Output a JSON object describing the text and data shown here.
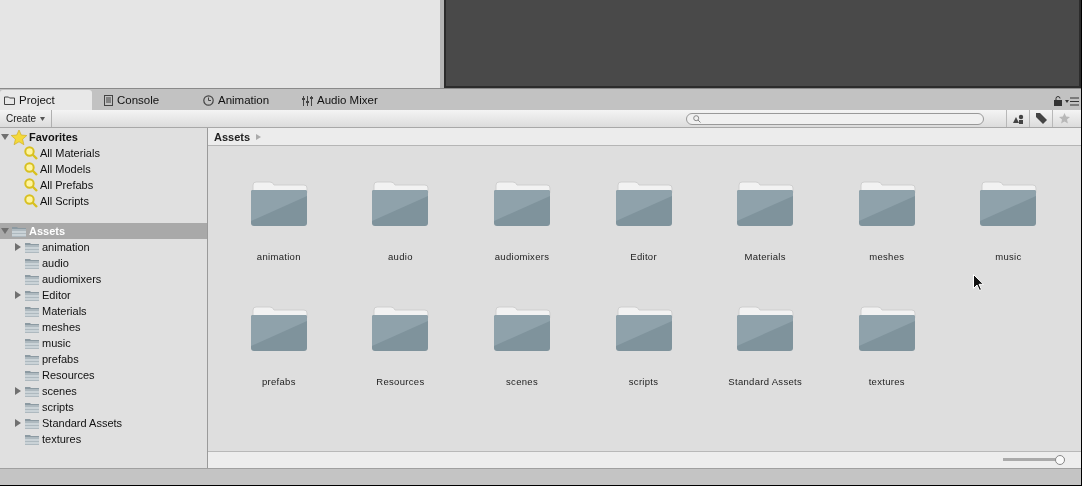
{
  "tabs": [
    {
      "label": "Project",
      "selected": true
    },
    {
      "label": "Console",
      "selected": false
    },
    {
      "label": "Animation",
      "selected": false
    },
    {
      "label": "Audio Mixer",
      "selected": false
    }
  ],
  "toolbar": {
    "create": "Create"
  },
  "favorites": {
    "label": "Favorites",
    "expanded": true,
    "items": [
      "All Materials",
      "All Models",
      "All Prefabs",
      "All Scripts"
    ]
  },
  "assets_tree": {
    "label": "Assets",
    "expanded": true,
    "selected": true,
    "children": [
      {
        "label": "animation",
        "has_children": true
      },
      {
        "label": "audio",
        "has_children": false
      },
      {
        "label": "audiomixers",
        "has_children": false
      },
      {
        "label": "Editor",
        "has_children": true
      },
      {
        "label": "Materials",
        "has_children": false
      },
      {
        "label": "meshes",
        "has_children": false
      },
      {
        "label": "music",
        "has_children": false
      },
      {
        "label": "prefabs",
        "has_children": false
      },
      {
        "label": "Resources",
        "has_children": false
      },
      {
        "label": "scenes",
        "has_children": true
      },
      {
        "label": "scripts",
        "has_children": false
      },
      {
        "label": "Standard Assets",
        "has_children": true
      },
      {
        "label": "textures",
        "has_children": false
      }
    ]
  },
  "breadcrumb": "Assets",
  "grid": {
    "items": [
      "animation",
      "audio",
      "audiomixers",
      "Editor",
      "Materials",
      "meshes",
      "music",
      "prefabs",
      "Resources",
      "scenes",
      "scripts",
      "Standard Assets",
      "textures"
    ]
  },
  "zoom_slider": {
    "level": 1
  }
}
